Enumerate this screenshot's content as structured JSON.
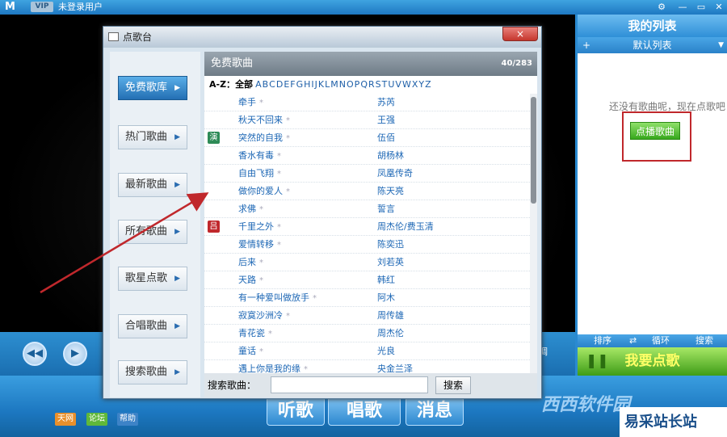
{
  "app": {
    "logo": "M",
    "vip": "VIP",
    "user": "未登录用户",
    "controls": {
      "right_label": "调"
    },
    "bottom_tabs": [
      "听歌",
      "唱歌",
      "消息"
    ],
    "bottom_tags": [
      "天网",
      "论坛",
      "帮助"
    ],
    "watermark": "西西软件园",
    "site_badge": "易采站长站"
  },
  "right_panel": {
    "title": "我的列表",
    "list_name": "默认列表",
    "add": "+",
    "dropdown": "▼",
    "empty_text": "还没有歌曲呢，现在点歌吧",
    "play_button": "点播歌曲",
    "toolbar": [
      "排序",
      "循环",
      "搜索"
    ],
    "request_button": "我要点歌"
  },
  "dialog": {
    "title": "点歌台",
    "close": "×",
    "sidebar": [
      {
        "label": "免费歌库",
        "active": true
      },
      {
        "label": "热门歌曲",
        "active": false
      },
      {
        "label": "最新歌曲",
        "active": false
      },
      {
        "label": "所有歌曲",
        "active": false
      },
      {
        "label": "歌星点歌",
        "active": false
      },
      {
        "label": "合唱歌曲",
        "active": false
      },
      {
        "label": "搜索歌曲",
        "active": false
      }
    ],
    "header": "免费歌曲",
    "count": "40/283",
    "az_label": "A-Z：",
    "az_all": "全部",
    "letters": [
      "A",
      "B",
      "C",
      "D",
      "E",
      "F",
      "G",
      "H",
      "I",
      "J",
      "K",
      "L",
      "M",
      "N",
      "O",
      "P",
      "Q",
      "R",
      "S",
      "T",
      "U",
      "V",
      "W",
      "X",
      "Y",
      "Z"
    ],
    "songs": [
      {
        "title": "牵手",
        "artist": "苏芮",
        "badge": ""
      },
      {
        "title": "秋天不回来",
        "artist": "王强",
        "badge": ""
      },
      {
        "title": "突然的自我",
        "artist": "伍佰",
        "badge": "演"
      },
      {
        "title": "香水有毒",
        "artist": "胡杨林",
        "badge": ""
      },
      {
        "title": "自由飞翔",
        "artist": "凤凰传奇",
        "badge": ""
      },
      {
        "title": "做你的爱人",
        "artist": "陈天亮",
        "badge": ""
      },
      {
        "title": "求佛",
        "artist": "誓言",
        "badge": ""
      },
      {
        "title": "千里之外",
        "artist": "周杰伦/费玉清",
        "badge": "吕"
      },
      {
        "title": "爱情转移",
        "artist": "陈奕迅",
        "badge": ""
      },
      {
        "title": "后来",
        "artist": "刘若英",
        "badge": ""
      },
      {
        "title": "天路",
        "artist": "韩红",
        "badge": ""
      },
      {
        "title": "有一种爱叫做放手",
        "artist": "阿木",
        "badge": ""
      },
      {
        "title": "寂寞沙洲冷",
        "artist": "周传雄",
        "badge": ""
      },
      {
        "title": "青花瓷",
        "artist": "周杰伦",
        "badge": ""
      },
      {
        "title": "童话",
        "artist": "光良",
        "badge": ""
      },
      {
        "title": "遇上你是我的缘",
        "artist": "央金兰泽",
        "badge": ""
      }
    ],
    "search_label": "搜索歌曲：",
    "search_value": "",
    "search_button": "搜索"
  },
  "colors": {
    "accent": "#2a82c9",
    "play_green": "#37a81c",
    "highlight_red": "#c0282c",
    "link_blue": "#1d67b5"
  }
}
